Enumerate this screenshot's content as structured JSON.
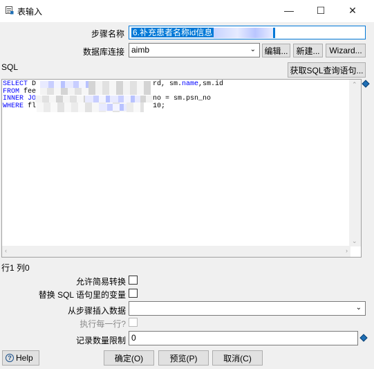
{
  "window": {
    "title": "表输入",
    "icon": "table-input-icon",
    "minimize": "—",
    "maximize": "☐",
    "close": "✕"
  },
  "step_name": {
    "label": "步骤名称",
    "value": "6.补充患者名称id信息"
  },
  "connection": {
    "label": "数据库连接",
    "value": "aimb",
    "edit_label": "编辑...",
    "new_label": "新建...",
    "wizard_label": "Wizard..."
  },
  "sql": {
    "label": "SQL",
    "get_query_label": "获取SQL查询语句...",
    "lines": {
      "l1_kw": "SELECT",
      "l1_a": " D",
      "l1_b": "rd, sm.",
      "l1_c": "name",
      "l1_d": ",sm.id",
      "l2_kw": "FROM",
      "l2_a": " fee",
      "l3_kw": "INNER JO",
      "l3_a": "no = sm.psn_no",
      "l4_kw": "WHERE",
      "l4_a": " fl",
      "l4_b": "10;"
    },
    "position": "行1 列0"
  },
  "options": {
    "lazy_conversion_label": "允许简易转换",
    "replace_vars_label": "替换 SQL 语句里的变量",
    "insert_from_step_label": "从步骤插入数据",
    "insert_from_step_value": "",
    "execute_each_row_label": "执行每一行?",
    "limit_label": "记录数量限制",
    "limit_value": "0"
  },
  "footer": {
    "help_label": "Help",
    "ok_label": "确定(O)",
    "preview_label": "预览(P)",
    "cancel_label": "取消(C)"
  }
}
